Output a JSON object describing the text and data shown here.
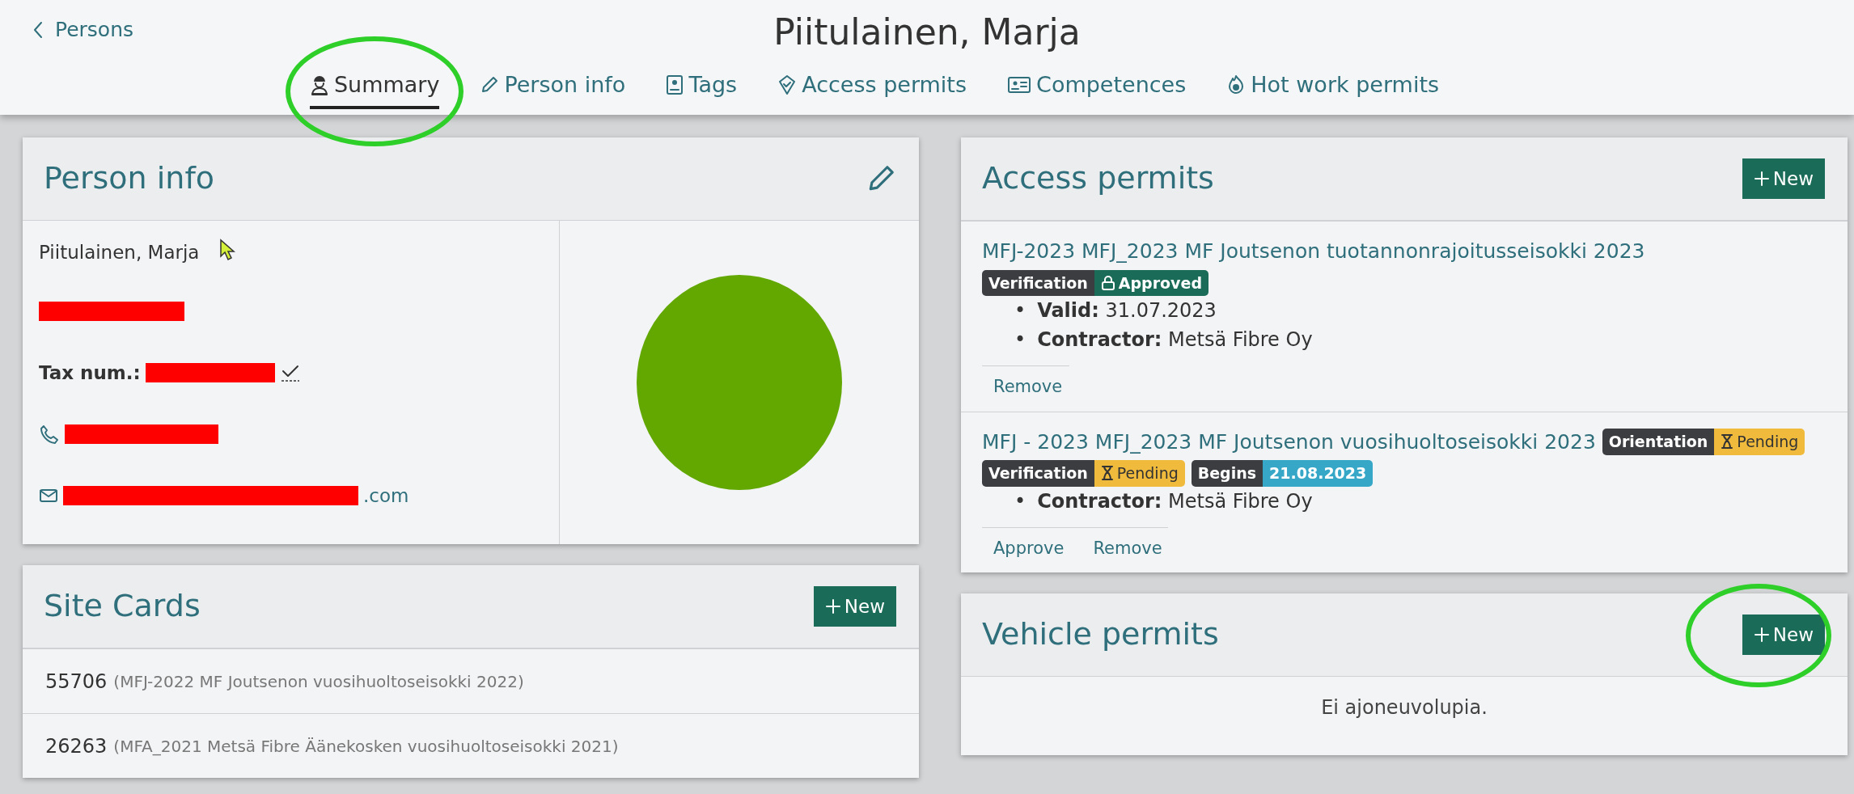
{
  "back_link": {
    "label": "Persons"
  },
  "title": "Piitulainen, Marja",
  "tabs": [
    {
      "label": "Summary",
      "selected": true,
      "annotated": true
    },
    {
      "label": "Person info",
      "selected": false,
      "annotated": false
    },
    {
      "label": "Tags",
      "selected": false,
      "annotated": false
    },
    {
      "label": "Access permits",
      "selected": false,
      "annotated": false
    },
    {
      "label": "Competences",
      "selected": false,
      "annotated": false
    },
    {
      "label": "Hot work permits",
      "selected": false,
      "annotated": false
    }
  ],
  "person_info": {
    "title": "Person info",
    "name": "Piitulainen, Marja",
    "tax_label": "Tax num.:",
    "tax_verified": true,
    "email_visible": ".com"
  },
  "site_cards": {
    "title": "Site Cards",
    "new_button": {
      "label": "New",
      "annotated": false
    },
    "rows": [
      {
        "number": "55706",
        "site": "(MFJ-2022 MF Joutsenon vuosihuoltoseisokki 2022)"
      },
      {
        "number": "26263",
        "site": "(MFA_2021 Metsä Fibre Äänekosken vuosihuoltoseisokki 2021)"
      }
    ]
  },
  "access_permits": {
    "title": "Access permits",
    "new_button": {
      "label": "New",
      "annotated": false
    },
    "items": [
      {
        "title": "MFJ-2023 MFJ_2023 MF Joutsenon tuotannonrajoitusseisokki 2023",
        "badges": [
          {
            "label": "Verification",
            "value": "Approved",
            "kind": "approved"
          }
        ],
        "details": [
          {
            "bullet": "•",
            "label": "Valid:",
            "value": "31.07.2023"
          },
          {
            "bullet": "•",
            "label": "Contractor:",
            "value": "Metsä Fibre Oy"
          }
        ],
        "actions": [
          "Remove"
        ]
      },
      {
        "title": "MFJ - 2023 MFJ_2023 MF Joutsenon vuosihuoltoseisokki 2023",
        "title_badges": [
          {
            "label": "Orientation",
            "value": "Pending",
            "kind": "pending"
          }
        ],
        "badges": [
          {
            "label": "Verification",
            "value": "Pending",
            "kind": "pending"
          },
          {
            "label": "Begins",
            "value": "21.08.2023",
            "kind": "date"
          }
        ],
        "details": [
          {
            "bullet": "•",
            "label": "Contractor:",
            "value": "Metsä Fibre Oy"
          }
        ],
        "actions": [
          "Approve",
          "Remove"
        ]
      }
    ]
  },
  "vehicle_permits": {
    "title": "Vehicle permits",
    "new_button": {
      "label": "New",
      "annotated": true
    },
    "empty": "Ei ajoneuvolupia."
  }
}
